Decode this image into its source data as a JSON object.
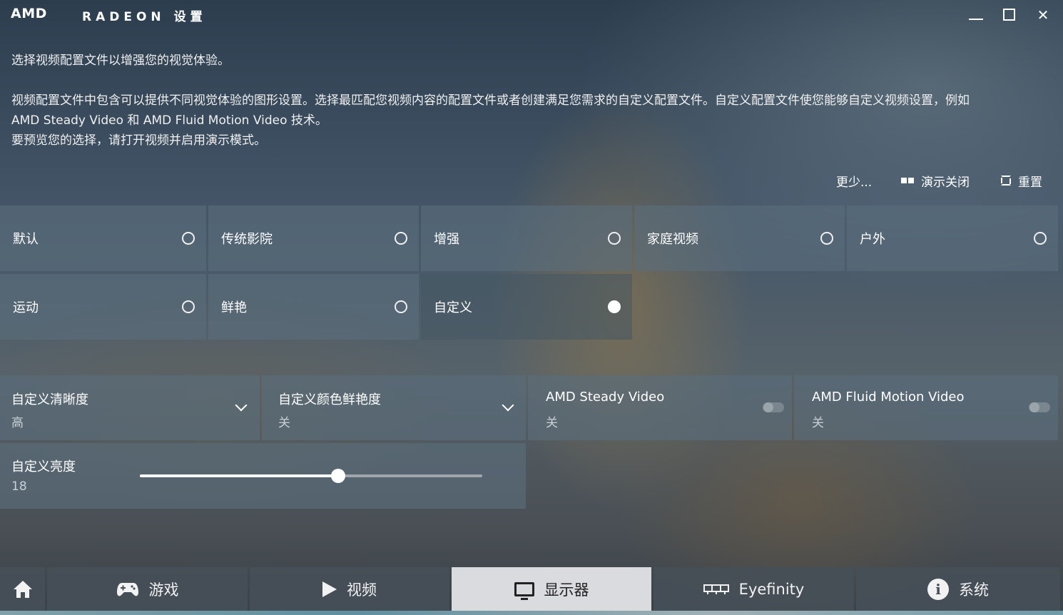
{
  "titlebar": {
    "brand": "AMD",
    "product": "RADEON",
    "title": "设置",
    "controls": [
      "minimize",
      "maximize",
      "close"
    ]
  },
  "description": {
    "line1": "选择视频配置文件以增强您的视觉体验。",
    "line2": "视频配置文件中包含可以提供不同视觉体验的图形设置。选择最匹配您视频内容的配置文件或者创建满足您需求的自定义配置文件。自定义配置文件使您能够自定义视频设置，例如",
    "line3": "AMD Steady Video 和 AMD Fluid Motion Video 技术。",
    "line4": "要预览您的选择，请打开视频并启用演示模式。"
  },
  "toolbar": {
    "more": "更少...",
    "demo": "演示关闭",
    "reset": "重置"
  },
  "profiles": [
    {
      "label": "默认",
      "selected": false
    },
    {
      "label": "传统影院",
      "selected": false
    },
    {
      "label": "增强",
      "selected": false
    },
    {
      "label": "家庭视频",
      "selected": false
    },
    {
      "label": "户外",
      "selected": false
    },
    {
      "label": "运动",
      "selected": false
    },
    {
      "label": "鲜艳",
      "selected": false
    },
    {
      "label": "自定义",
      "selected": true
    }
  ],
  "settings": {
    "sharpness": {
      "label": "自定义清晰度",
      "value": "高"
    },
    "vividness": {
      "label": "自定义颜色鲜艳度",
      "value": "关"
    },
    "steady": {
      "label": "AMD Steady Video",
      "value": "关",
      "enabled": false
    },
    "fluid": {
      "label": "AMD Fluid Motion Video",
      "value": "关",
      "enabled": false
    },
    "brightness": {
      "label": "自定义亮度",
      "value": "18",
      "slider_fraction": 0.58
    }
  },
  "nav": {
    "home_icon": "home-icon",
    "items": [
      {
        "label": "游戏",
        "icon": "gamepad-icon"
      },
      {
        "label": "视频",
        "icon": "play-icon"
      },
      {
        "label": "显示器",
        "icon": "monitor-icon",
        "active": true
      },
      {
        "label": "Eyefinity",
        "icon": "eyefinity-icon"
      },
      {
        "label": "系统",
        "icon": "info-icon"
      }
    ]
  },
  "colors": {
    "panel": "#5a6e7d",
    "active_nav": "#e1e4e6",
    "text": "#ffffff"
  }
}
